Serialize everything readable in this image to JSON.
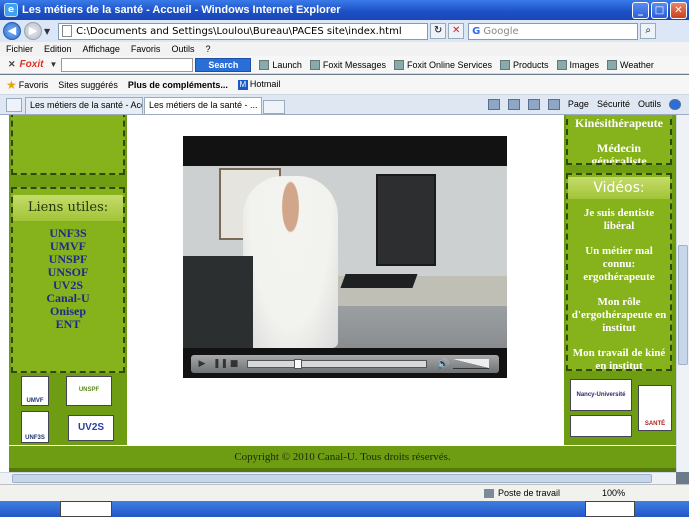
{
  "window": {
    "title": "Les métiers de la santé - Accueil - Windows Internet Explorer",
    "min": "_",
    "max": "□",
    "close": "✕"
  },
  "address": {
    "url": "C:\\Documents and Settings\\Loulou\\Bureau\\PACES site\\index.html",
    "search_placeholder": "Google"
  },
  "menu": [
    "Fichier",
    "Edition",
    "Affichage",
    "Favoris",
    "Outils",
    "?"
  ],
  "foxit": {
    "logo": "Foxit",
    "search_label": "Search",
    "items": [
      "Launch",
      "Foxit Messages",
      "Foxit Online Services",
      "Products",
      "Images",
      "Weather"
    ]
  },
  "favorites": {
    "label": "Favoris",
    "items": [
      "Sites suggérés",
      "Plus de compléments...",
      "Hotmail"
    ]
  },
  "tabs": [
    {
      "label": "Les métiers de la santé - Acc...",
      "active": false
    },
    {
      "label": "Les métiers de la santé - ...",
      "active": true
    }
  ],
  "commands": [
    "Page",
    "Sécurité",
    "Outils"
  ],
  "left": {
    "links_title": "Liens utiles:",
    "links": [
      "UNF3S",
      "UMVF",
      "UNSPF",
      "UNSOF",
      "UV2S",
      "Canal-U",
      "Onisep",
      "ENT"
    ],
    "logos": [
      "UMVF",
      "UNSPF",
      "UNF3S",
      "UV2S"
    ]
  },
  "right": {
    "top_items": [
      "Kinésithérapeute",
      "Médecin généraliste"
    ],
    "videos_title": "Vidéos:",
    "videos": [
      "Je suis dentiste libéral",
      "Un métier mal connu: ergothérapeute",
      "Mon rôle d'ergothérapeute en institut",
      "Mon travail de kiné en institut"
    ],
    "logos": [
      "Nancy-Université",
      "SANTÉ"
    ]
  },
  "player": {
    "progress": 0.28,
    "volume": 0.8
  },
  "footer": {
    "copyright": "Copyright © 2010 Canal-U. Tous droits réservés."
  },
  "status": {
    "zone": "Poste de travail",
    "zoom": "100%"
  },
  "colors": {
    "page_green": "#6e9c12",
    "panel_green": "#86b21c",
    "link_blue": "#1d2a8e",
    "ie_blue": "#2456c8"
  }
}
